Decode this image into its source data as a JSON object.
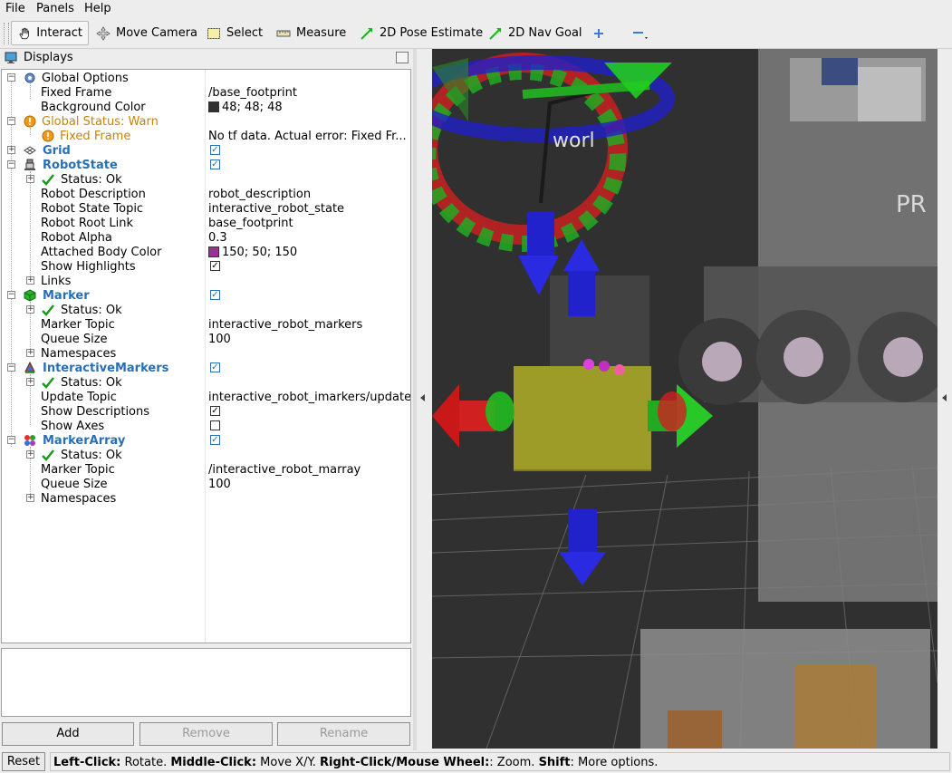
{
  "menu": [
    "File",
    "Panels",
    "Help"
  ],
  "toolbar": {
    "tools": [
      {
        "label": "Interact",
        "icon": "hand-icon"
      },
      {
        "label": "Move Camera",
        "icon": "move-camera-icon"
      },
      {
        "label": "Select",
        "icon": "select-icon"
      },
      {
        "label": "Measure",
        "icon": "ruler-icon"
      },
      {
        "label": "2D Pose Estimate",
        "icon": "pose-estimate-arrow-icon"
      },
      {
        "label": "2D Nav Goal",
        "icon": "nav-goal-arrow-icon"
      }
    ],
    "add_icon": "plus-icon",
    "remove_icon": "minus-icon"
  },
  "displays_panel": {
    "title": "Displays",
    "rows": [
      {
        "name": "Global Options",
        "value": ""
      },
      {
        "name": "Fixed Frame",
        "value": "/base_footprint"
      },
      {
        "name": "Background Color",
        "value": "48; 48; 48",
        "swatch": "#303030"
      },
      {
        "name": "Global Status: Warn",
        "value": ""
      },
      {
        "name": "Fixed Frame",
        "value": "No tf data.  Actual error: Fixed Fr..."
      },
      {
        "name": "Grid",
        "checked": true
      },
      {
        "name": "RobotState",
        "checked": true
      },
      {
        "name": "Status: Ok",
        "value": ""
      },
      {
        "name": "Robot Description",
        "value": "robot_description"
      },
      {
        "name": "Robot State Topic",
        "value": "interactive_robot_state"
      },
      {
        "name": "Robot Root Link",
        "value": "base_footprint"
      },
      {
        "name": "Robot Alpha",
        "value": "0.3"
      },
      {
        "name": "Attached Body Color",
        "value": "150; 50; 150",
        "swatch": "#963296"
      },
      {
        "name": "Show Highlights",
        "checked": true
      },
      {
        "name": "Links",
        "value": ""
      },
      {
        "name": "Marker",
        "checked": true
      },
      {
        "name": "Status: Ok",
        "value": ""
      },
      {
        "name": "Marker Topic",
        "value": "interactive_robot_markers"
      },
      {
        "name": "Queue Size",
        "value": "100"
      },
      {
        "name": "Namespaces",
        "value": ""
      },
      {
        "name": "InteractiveMarkers",
        "checked": true
      },
      {
        "name": "Status: Ok",
        "value": ""
      },
      {
        "name": "Update Topic",
        "value": "interactive_robot_imarkers/update"
      },
      {
        "name": "Show Descriptions",
        "checked": true
      },
      {
        "name": "Show Axes",
        "checked": false
      },
      {
        "name": "MarkerArray",
        "checked": true
      },
      {
        "name": "Status: Ok",
        "value": ""
      },
      {
        "name": "Marker Topic",
        "value": "/interactive_robot_marray"
      },
      {
        "name": "Queue Size",
        "value": "100"
      },
      {
        "name": "Namespaces",
        "value": ""
      }
    ],
    "buttons": {
      "add": "Add",
      "remove": "Remove",
      "rename": "Rename"
    }
  },
  "viewport": {
    "frame_label": "worl",
    "robot_label": "PR"
  },
  "statusbar": {
    "reset": "Reset",
    "hint": [
      {
        "b": "Left-Click:",
        "t": " Rotate. "
      },
      {
        "b": "Middle-Click:",
        "t": " Move X/Y. "
      },
      {
        "b": "Right-Click/Mouse Wheel:",
        "t": ": Zoom. "
      },
      {
        "b": "Shift",
        "t": ": More options."
      }
    ]
  },
  "colors": {
    "link_blue": "#2a6fb4",
    "warn": "#c88400",
    "grid_bg": "#303030"
  }
}
